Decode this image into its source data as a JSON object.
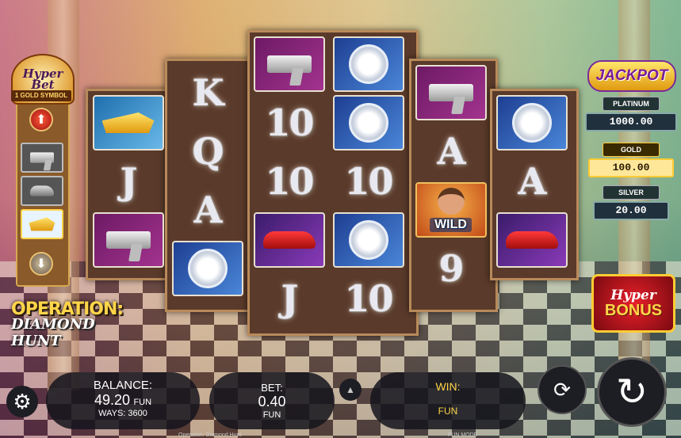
{
  "hyper_bet": {
    "title": "Hyper Bet",
    "subtitle": "1 GOLD SYMBOL",
    "up_icon": "arrow-up-icon",
    "down_icon": "arrow-down-icon",
    "options": [
      "gun",
      "car",
      "yacht"
    ],
    "selected_option": "yacht"
  },
  "logo": {
    "line1": "OPERATION:",
    "line2": "DIAMOND HUNT"
  },
  "reels": [
    [
      "yacht",
      "J",
      "gun"
    ],
    [
      "K",
      "Q",
      "A",
      "watch"
    ],
    [
      "gun",
      "10",
      "10",
      "car",
      "J"
    ],
    [
      "watch",
      "watch",
      "10",
      "watch",
      "10"
    ],
    [
      "gun",
      "A",
      "wild",
      "9"
    ],
    [
      "watch",
      "A",
      "car"
    ]
  ],
  "wild_label": "WILD",
  "jackpot": {
    "title": "JACKPOT",
    "tiers": [
      {
        "name": "PLATINUM",
        "value": "1000.00"
      },
      {
        "name": "GOLD",
        "value": "100.00"
      },
      {
        "name": "SILVER",
        "value": "20.00"
      }
    ]
  },
  "hyper_bonus": {
    "line1": "Hyper",
    "line2": "BONUS"
  },
  "bottom_bar": {
    "balance_label": "BALANCE:",
    "balance_value": "49.20",
    "balance_currency": "FUN",
    "ways": "WAYS: 3600",
    "bet_label": "BET:",
    "bet_value": "0.40",
    "bet_currency": "FUN",
    "win_label": "WIN:",
    "win_currency": "FUN",
    "footer_left": "Operation: Diamond Hunt",
    "footer_right": "FUN MODE"
  },
  "colors": {
    "gold": "#ffd54a",
    "panel": "#1d1d24",
    "wood": "#5a3a2a"
  }
}
